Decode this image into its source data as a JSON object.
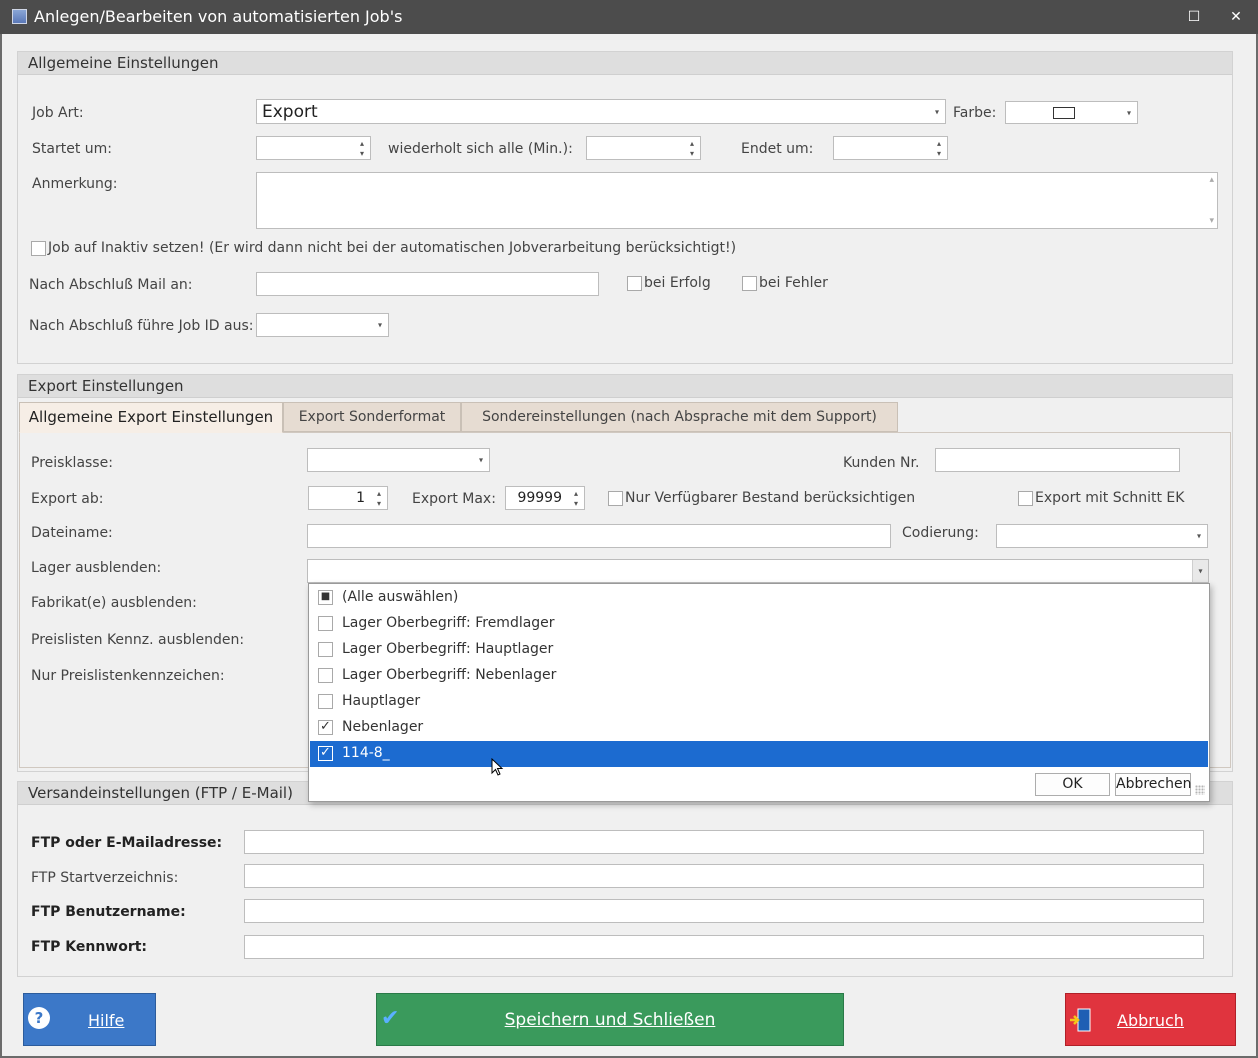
{
  "window": {
    "title": "Anlegen/Bearbeiten von automatisierten Job's",
    "maximize_glyph": "☐",
    "close_glyph": "✕"
  },
  "general": {
    "header": "Allgemeine Einstellungen",
    "job_art_label": "Job Art:",
    "job_art_value": "Export",
    "farbe_label": "Farbe:",
    "startet_label": "Startet um:",
    "wiederholt_label": "wiederholt sich alle (Min.):",
    "endet_label": "Endet um:",
    "anmerkung_label": "Anmerkung:",
    "inaktiv_label": "Job auf Inaktiv setzen! (Er wird dann nicht bei der automatischen Jobverarbeitung berücksichtigt!)",
    "mail_label": "Nach Abschluß Mail an:",
    "bei_erfolg_label": "bei Erfolg",
    "bei_fehler_label": "bei Fehler",
    "job_id_label": "Nach Abschluß führe Job ID aus:"
  },
  "export": {
    "header": "Export Einstellungen",
    "tabs": [
      {
        "label": "Allgemeine Export Einstellungen",
        "active": true
      },
      {
        "label": "Export Sonderformat",
        "active": false
      },
      {
        "label": "Sondereinstellungen (nach Absprache mit dem Support)",
        "active": false
      }
    ],
    "preisklasse_label": "Preisklasse:",
    "kunden_nr_label": "Kunden Nr.",
    "export_ab_label": "Export ab:",
    "export_ab_value": "1",
    "export_max_label": "Export Max:",
    "export_max_value": "99999",
    "nur_verfuegbar_label": "Nur Verfügbarer Bestand berücksichtigen",
    "schnitt_ek_label": "Export mit Schnitt EK",
    "dateiname_label": "Dateiname:",
    "codierung_label": "Codierung:",
    "lager_label": "Lager ausblenden:",
    "fabrikat_label": "Fabrikat(e) ausblenden:",
    "preislisten_label": "Preislisten Kennz. ausblenden:",
    "nur_preislisten_label": "Nur Preislistenkennzeichen:"
  },
  "lager_dropdown": {
    "items": [
      {
        "label": "(Alle auswählen)",
        "state": "indeterminate",
        "mark": "■"
      },
      {
        "label": "Lager Oberbegriff: Fremdlager",
        "state": "unchecked",
        "mark": ""
      },
      {
        "label": "Lager Oberbegriff: Hauptlager",
        "state": "unchecked",
        "mark": ""
      },
      {
        "label": "Lager Oberbegriff: Nebenlager",
        "state": "unchecked",
        "mark": ""
      },
      {
        "label": "Hauptlager",
        "state": "unchecked",
        "mark": ""
      },
      {
        "label": "Nebenlager",
        "state": "checked",
        "mark": "✓"
      },
      {
        "label": "114-8_",
        "state": "checked",
        "mark": "✓",
        "selected": true
      }
    ],
    "ok_label": "OK",
    "cancel_label": "Abbrechen"
  },
  "shipping": {
    "header": "Versandeinstellungen (FTP / E-Mail)",
    "ftp_address_label": "FTP oder E-Mailadresse:",
    "ftp_start_label": "FTP Startverzeichnis:",
    "ftp_user_label": "FTP Benutzername:",
    "ftp_password_label": "FTP Kennwort:"
  },
  "footer": {
    "help_label": "Hilfe",
    "save_label": "Speichern und Schließen",
    "cancel_label": "Abbruch",
    "help_color": "#3c78c8",
    "save_color": "#3a9a5c",
    "cancel_color": "#e0343e"
  },
  "glyphs": {
    "dropdown": "▾",
    "spin_up": "▴",
    "spin_down": "▾",
    "help_icon": "?",
    "save_icon": "✔",
    "scroll_up": "▴",
    "scroll_down": "▾"
  }
}
